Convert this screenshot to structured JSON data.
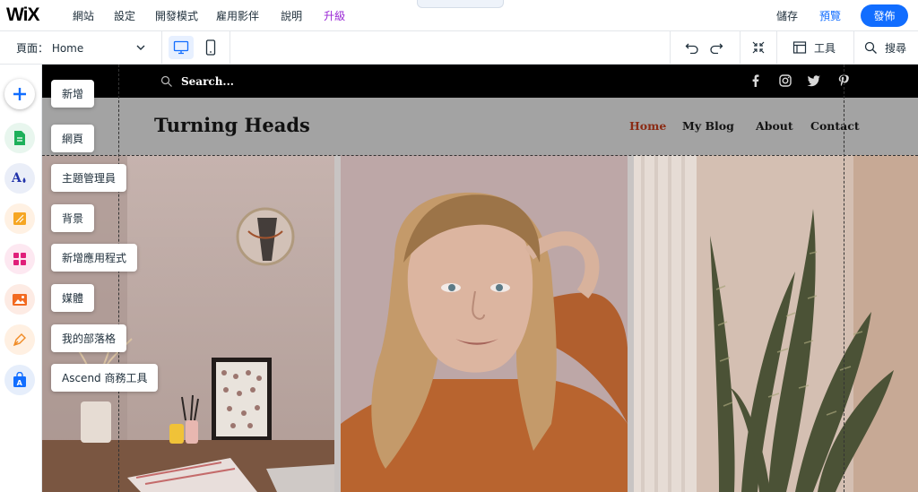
{
  "topbar": {
    "logo": "WiX",
    "menu": [
      "網站",
      "設定",
      "開發模式",
      "雇用影伴",
      "說明",
      "升級"
    ],
    "save": "儲存",
    "preview": "預覽",
    "publish": "發佈"
  },
  "secondbar": {
    "page_label": "頁面： Home",
    "tools_label": "工具",
    "search_label": "搜尋"
  },
  "add_panel": {
    "items": [
      "新增",
      "網頁",
      "主題管理員",
      "背景",
      "新增應用程式",
      "媒體",
      "我的部落格",
      "Ascend 商務工具"
    ]
  },
  "site": {
    "search_placeholder": "Search...",
    "title": "Turning Heads",
    "nav": [
      "Home",
      "My Blog",
      "About",
      "Contact"
    ]
  },
  "colors": {
    "accent": "#116dff",
    "upgrade": "#9a27d5",
    "nav_active": "#8b2b14"
  }
}
